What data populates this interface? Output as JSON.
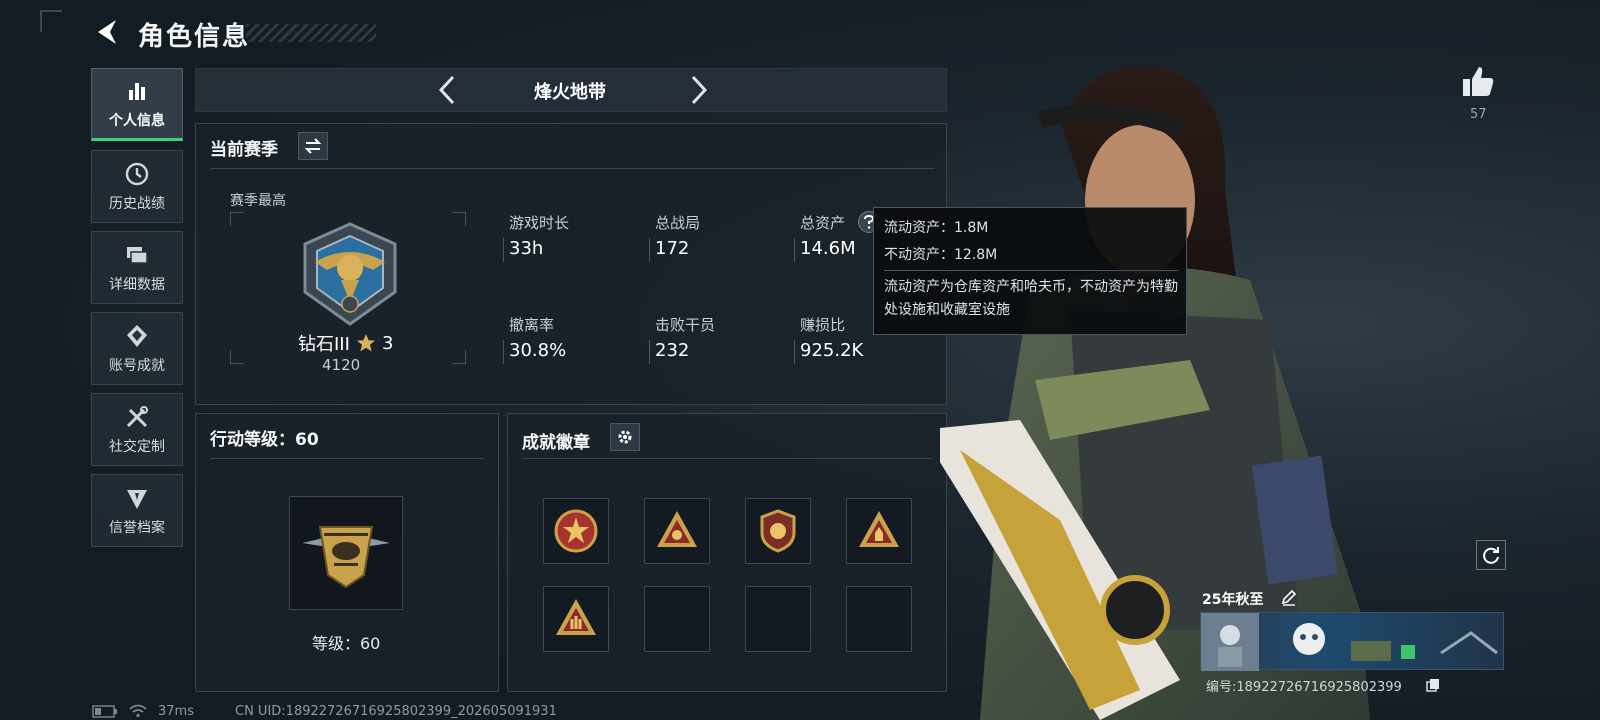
{
  "header": {
    "title": "角色信息"
  },
  "sidebar": {
    "items": [
      {
        "label": "个人信息",
        "icon": "bar-chart-icon",
        "active": true
      },
      {
        "label": "历史战绩",
        "icon": "clock-icon"
      },
      {
        "label": "详细数据",
        "icon": "folders-icon"
      },
      {
        "label": "账号成就",
        "icon": "achievement-icon"
      },
      {
        "label": "社交定制",
        "icon": "tools-icon"
      },
      {
        "label": "信誉档案",
        "icon": "credit-icon"
      }
    ]
  },
  "mode": {
    "title": "烽火地带"
  },
  "season": {
    "heading": "当前赛季",
    "best_label": "赛季最高",
    "rank_name": "钻石III",
    "rank_stars": "3",
    "rank_score": "4120",
    "stats": [
      {
        "label": "游戏时长",
        "value": "33h"
      },
      {
        "label": "总战局",
        "value": "172"
      },
      {
        "label": "总资产",
        "value": "14.6M"
      },
      {
        "label": "撤离率",
        "value": "30.8%"
      },
      {
        "label": "击败干员",
        "value": "232"
      },
      {
        "label": "赚损比",
        "value": "925.2K"
      }
    ]
  },
  "action_level": {
    "heading": "行动等级：60",
    "level_text": "等级：60"
  },
  "achievements": {
    "heading": "成就徽章",
    "filled_slots": 5,
    "total_slots": 8
  },
  "tooltip": {
    "liquid": "流动资产：1.8M",
    "fixed": "不动资产：12.8M",
    "desc": "流动资产为仓库资产和哈夫币，不动资产为特勤处设施和收藏室设施"
  },
  "likes": {
    "count": "57"
  },
  "card": {
    "title": "25年秋至",
    "id": "编号:18922726716925802399"
  },
  "status": {
    "ping": "37ms",
    "uid": "CN UID:18922726716925802399_202605091931"
  },
  "colors": {
    "accent_green": "#3ed17a",
    "gold": "#c9a24c",
    "panel_bg": "#1a2229"
  }
}
